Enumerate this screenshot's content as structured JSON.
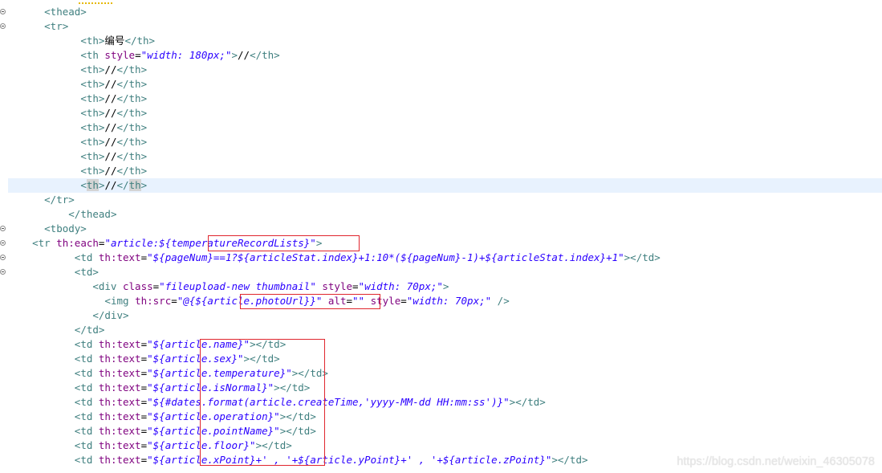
{
  "editor": {
    "lines": [
      {
        "id": "l1",
        "indent": "      ",
        "tokens": [
          {
            "t": "<thead>",
            "c": "tag"
          }
        ]
      },
      {
        "id": "l2",
        "indent": "      ",
        "tokens": [
          {
            "t": "<tr>",
            "c": "tag"
          }
        ]
      },
      {
        "id": "l3",
        "indent": "            ",
        "tokens": [
          {
            "t": "<th>",
            "c": "tag"
          },
          {
            "t": "编号",
            "c": "txt"
          },
          {
            "t": "</th>",
            "c": "tag"
          }
        ]
      },
      {
        "id": "l4",
        "indent": "            ",
        "tokens": [
          {
            "t": "<th ",
            "c": "tag"
          },
          {
            "t": "style",
            "c": "attr"
          },
          {
            "t": "=",
            "c": "txt"
          },
          {
            "t": "\"width: 180px;\"",
            "c": "val"
          },
          {
            "t": ">",
            "c": "tag"
          },
          {
            "t": "//",
            "c": "txt"
          },
          {
            "t": "</th>",
            "c": "tag"
          }
        ]
      },
      {
        "id": "l5",
        "indent": "            ",
        "tokens": [
          {
            "t": "<th>",
            "c": "tag"
          },
          {
            "t": "//",
            "c": "txt"
          },
          {
            "t": "</th>",
            "c": "tag"
          }
        ]
      },
      {
        "id": "l6",
        "indent": "            ",
        "tokens": [
          {
            "t": "<th>",
            "c": "tag"
          },
          {
            "t": "//",
            "c": "txt"
          },
          {
            "t": "</th>",
            "c": "tag"
          }
        ]
      },
      {
        "id": "l7",
        "indent": "            ",
        "tokens": [
          {
            "t": "<th>",
            "c": "tag"
          },
          {
            "t": "//",
            "c": "txt"
          },
          {
            "t": "</th>",
            "c": "tag"
          }
        ]
      },
      {
        "id": "l8",
        "indent": "            ",
        "tokens": [
          {
            "t": "<th>",
            "c": "tag"
          },
          {
            "t": "//",
            "c": "txt"
          },
          {
            "t": "</th>",
            "c": "tag"
          }
        ]
      },
      {
        "id": "l9",
        "indent": "            ",
        "tokens": [
          {
            "t": "<th>",
            "c": "tag"
          },
          {
            "t": "//",
            "c": "txt"
          },
          {
            "t": "</th>",
            "c": "tag"
          }
        ]
      },
      {
        "id": "l10",
        "indent": "            ",
        "tokens": [
          {
            "t": "<th>",
            "c": "tag"
          },
          {
            "t": "//",
            "c": "txt"
          },
          {
            "t": "</th>",
            "c": "tag"
          }
        ]
      },
      {
        "id": "l11",
        "indent": "            ",
        "tokens": [
          {
            "t": "<th>",
            "c": "tag"
          },
          {
            "t": "//",
            "c": "txt"
          },
          {
            "t": "</th>",
            "c": "tag"
          }
        ]
      },
      {
        "id": "l12",
        "indent": "            ",
        "tokens": [
          {
            "t": "<th>",
            "c": "tag"
          },
          {
            "t": "//",
            "c": "txt"
          },
          {
            "t": "</th>",
            "c": "tag"
          }
        ]
      },
      {
        "id": "l13",
        "indent": "            ",
        "current": true,
        "tokens": [
          {
            "t": "<",
            "c": "tag"
          },
          {
            "t": "th",
            "c": "tag hl"
          },
          {
            "t": ">",
            "c": "tag"
          },
          {
            "t": "//",
            "c": "txt"
          },
          {
            "t": "</",
            "c": "tag"
          },
          {
            "t": "th",
            "c": "tag hl"
          },
          {
            "t": ">",
            "c": "tag"
          }
        ]
      },
      {
        "id": "l14",
        "indent": "      ",
        "tokens": [
          {
            "t": "</tr>",
            "c": "tag"
          }
        ]
      },
      {
        "id": "l15",
        "indent": "          ",
        "tokens": [
          {
            "t": "</thead>",
            "c": "tag"
          }
        ]
      },
      {
        "id": "l16",
        "indent": "      ",
        "tokens": [
          {
            "t": "<tbody>",
            "c": "tag"
          }
        ]
      },
      {
        "id": "l17",
        "indent": "    ",
        "tokens": [
          {
            "t": "<tr ",
            "c": "tag"
          },
          {
            "t": "th:each",
            "c": "attr"
          },
          {
            "t": "=",
            "c": "txt"
          },
          {
            "t": "\"article:${temperatureRecordLists}\"",
            "c": "val"
          },
          {
            "t": ">",
            "c": "tag"
          }
        ]
      },
      {
        "id": "l18",
        "indent": "           ",
        "tokens": [
          {
            "t": "<td ",
            "c": "tag"
          },
          {
            "t": "th:text",
            "c": "attr"
          },
          {
            "t": "=",
            "c": "txt"
          },
          {
            "t": "\"${pageNum}==1?${articleStat.index}+1:10*(${pageNum}-1)+${articleStat.index}+1\"",
            "c": "val"
          },
          {
            "t": "></td>",
            "c": "tag"
          }
        ]
      },
      {
        "id": "l19",
        "indent": "           ",
        "tokens": [
          {
            "t": "<td>",
            "c": "tag"
          }
        ]
      },
      {
        "id": "l20",
        "indent": "              ",
        "tokens": [
          {
            "t": "<div ",
            "c": "tag"
          },
          {
            "t": "class",
            "c": "attr"
          },
          {
            "t": "=",
            "c": "txt"
          },
          {
            "t": "\"fileupload-new thumbnail\"",
            "c": "val"
          },
          {
            "t": " ",
            "c": "txt"
          },
          {
            "t": "style",
            "c": "attr"
          },
          {
            "t": "=",
            "c": "txt"
          },
          {
            "t": "\"width: 70px;\"",
            "c": "val"
          },
          {
            "t": ">",
            "c": "tag"
          }
        ]
      },
      {
        "id": "l21",
        "indent": "                ",
        "tokens": [
          {
            "t": "<img ",
            "c": "tag"
          },
          {
            "t": "th:src",
            "c": "attr"
          },
          {
            "t": "=",
            "c": "txt"
          },
          {
            "t": "\"@{${article.photoUrl}}\"",
            "c": "val"
          },
          {
            "t": " ",
            "c": "txt"
          },
          {
            "t": "alt",
            "c": "attr"
          },
          {
            "t": "=",
            "c": "txt"
          },
          {
            "t": "\"\"",
            "c": "val"
          },
          {
            "t": " ",
            "c": "txt"
          },
          {
            "t": "style",
            "c": "attr"
          },
          {
            "t": "=",
            "c": "txt"
          },
          {
            "t": "\"width: 70px;\"",
            "c": "val"
          },
          {
            "t": " />",
            "c": "tag"
          }
        ]
      },
      {
        "id": "l22",
        "indent": "              ",
        "tokens": [
          {
            "t": "</div>",
            "c": "tag"
          }
        ]
      },
      {
        "id": "l23",
        "indent": "           ",
        "tokens": [
          {
            "t": "</td>",
            "c": "tag"
          }
        ]
      },
      {
        "id": "l24",
        "indent": "           ",
        "tokens": [
          {
            "t": "<td ",
            "c": "tag"
          },
          {
            "t": "th:text",
            "c": "attr"
          },
          {
            "t": "=",
            "c": "txt"
          },
          {
            "t": "\"${article.name}\"",
            "c": "val"
          },
          {
            "t": "></td>",
            "c": "tag"
          }
        ]
      },
      {
        "id": "l25",
        "indent": "           ",
        "tokens": [
          {
            "t": "<td ",
            "c": "tag"
          },
          {
            "t": "th:text",
            "c": "attr"
          },
          {
            "t": "=",
            "c": "txt"
          },
          {
            "t": "\"${article.sex}\"",
            "c": "val"
          },
          {
            "t": "></td>",
            "c": "tag"
          }
        ]
      },
      {
        "id": "l26",
        "indent": "           ",
        "tokens": [
          {
            "t": "<td ",
            "c": "tag"
          },
          {
            "t": "th:text",
            "c": "attr"
          },
          {
            "t": "=",
            "c": "txt"
          },
          {
            "t": "\"${article.temperature}\"",
            "c": "val"
          },
          {
            "t": "></td>",
            "c": "tag"
          }
        ]
      },
      {
        "id": "l27",
        "indent": "           ",
        "tokens": [
          {
            "t": "<td ",
            "c": "tag"
          },
          {
            "t": "th:text",
            "c": "attr"
          },
          {
            "t": "=",
            "c": "txt"
          },
          {
            "t": "\"${article.isNormal}\"",
            "c": "val"
          },
          {
            "t": "></td>",
            "c": "tag"
          }
        ]
      },
      {
        "id": "l28",
        "indent": "           ",
        "tokens": [
          {
            "t": "<td ",
            "c": "tag"
          },
          {
            "t": "th:text",
            "c": "attr"
          },
          {
            "t": "=",
            "c": "txt"
          },
          {
            "t": "\"${#dates.format(article.createTime,'yyyy-MM-dd HH:mm:ss')}\"",
            "c": "val"
          },
          {
            "t": "></td>",
            "c": "tag"
          }
        ]
      },
      {
        "id": "l29",
        "indent": "           ",
        "tokens": [
          {
            "t": "<td ",
            "c": "tag"
          },
          {
            "t": "th:text",
            "c": "attr"
          },
          {
            "t": "=",
            "c": "txt"
          },
          {
            "t": "\"${article.operation}\"",
            "c": "val"
          },
          {
            "t": "></td>",
            "c": "tag"
          }
        ]
      },
      {
        "id": "l30",
        "indent": "           ",
        "tokens": [
          {
            "t": "<td ",
            "c": "tag"
          },
          {
            "t": "th:text",
            "c": "attr"
          },
          {
            "t": "=",
            "c": "txt"
          },
          {
            "t": "\"${article.pointName}\"",
            "c": "val"
          },
          {
            "t": "></td>",
            "c": "tag"
          }
        ]
      },
      {
        "id": "l31",
        "indent": "           ",
        "tokens": [
          {
            "t": "<td ",
            "c": "tag"
          },
          {
            "t": "th:text",
            "c": "attr"
          },
          {
            "t": "=",
            "c": "txt"
          },
          {
            "t": "\"${article.floor}\"",
            "c": "val"
          },
          {
            "t": "></td>",
            "c": "tag"
          }
        ]
      },
      {
        "id": "l32",
        "indent": "           ",
        "tokens": [
          {
            "t": "<td ",
            "c": "tag"
          },
          {
            "t": "th:text",
            "c": "attr"
          },
          {
            "t": "=",
            "c": "txt"
          },
          {
            "t": "\"${article.xPoint}+' , '+${article.yPoint}+' , '+${article.zPoint}\"",
            "c": "val"
          },
          {
            "t": "></td>",
            "c": "tag"
          }
        ]
      }
    ],
    "fold_markers": [
      "l1",
      "l2",
      "l16",
      "l17",
      "l18",
      "l19"
    ]
  },
  "watermark": "https://blog.csdn.net/weixin_46305078",
  "colors": {
    "tag": "#3f7f7f",
    "attr": "#7f007f",
    "value": "#2a00ff",
    "annotation": "#e0262e",
    "current_line": "#e8f2fe"
  }
}
